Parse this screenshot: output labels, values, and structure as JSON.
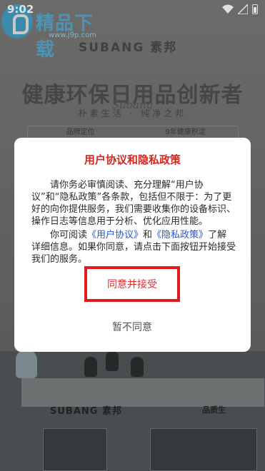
{
  "status_bar": {
    "time": "9:02"
  },
  "watermark": {
    "text": "精品下载",
    "url": "www.j9p.com"
  },
  "splash": {
    "brand": "SUBANG 素邦",
    "slogan": "健康环保日用品创新者",
    "script_logo": "Subang",
    "sub_slogan": "朴素生活 · 纯净之邦",
    "info_items": [
      "品牌定位",
      "9年健康积淀"
    ],
    "store_sign": "SUBANG 素邦",
    "store_sign_right": "品质生"
  },
  "dialog": {
    "title": "用户协议和隐私政策",
    "para1": "请你务必审慎阅读、充分理解“用户协议”和“隐私政策”各条款，包括但不限于：为了更好的向你提供服务，我们需要收集你的设备标识、操作日志等信息用于分析、优化应用性能。",
    "para2_before": "你可阅读",
    "link_agreement": "《用户协议》",
    "para2_and": "和",
    "link_privacy": "《隐私政策》",
    "para2_after": "了解详细信息。如果你同意，请点击下面按钮开始接受我们的服务。",
    "accept_label": "同意并接受",
    "decline_label": "暂不同意"
  },
  "colors": {
    "accent": "#d7261d",
    "link": "#2955c8"
  }
}
